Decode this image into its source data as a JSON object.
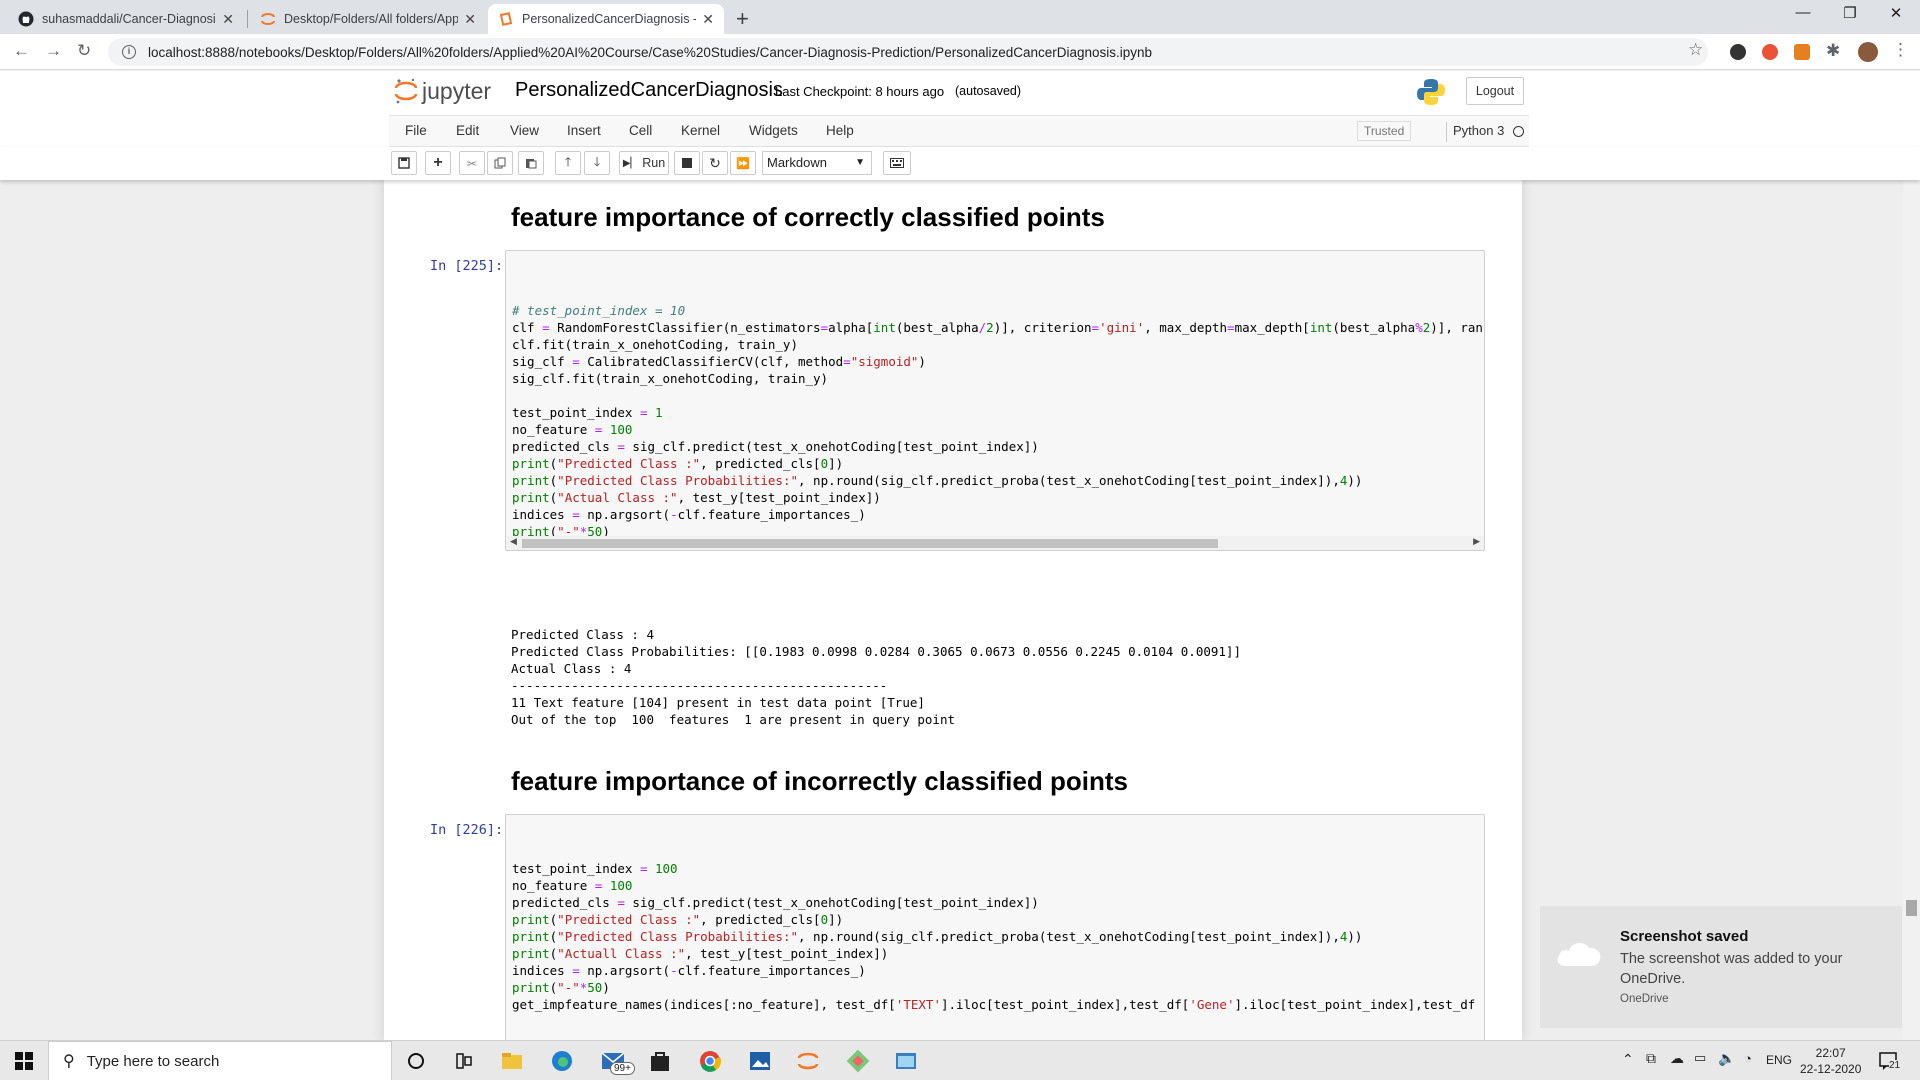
{
  "browser": {
    "tabs": [
      {
        "title": "suhasmaddali/Cancer-Diagnosis-",
        "icon": "github-icon"
      },
      {
        "title": "Desktop/Folders/All folders/Appl",
        "icon": "jupyter-icon"
      },
      {
        "title": "PersonalizedCancerDiagnosis - Ju",
        "icon": "notebook-icon"
      }
    ],
    "url": "localhost:8888/notebooks/Desktop/Folders/All%20folders/Applied%20AI%20Course/Case%20Studies/Cancer-Diagnosis-Prediction/PersonalizedCancerDiagnosis.ipynb"
  },
  "jupyter": {
    "logo_text": "jupyter",
    "notebook_name": "PersonalizedCancerDiagnosis",
    "checkpoint": "Last Checkpoint: 8 hours ago",
    "autosave": "(autosaved)",
    "logout": "Logout",
    "menu": [
      "File",
      "Edit",
      "View",
      "Insert",
      "Cell",
      "Kernel",
      "Widgets",
      "Help"
    ],
    "trusted": "Trusted",
    "kernel": "Python 3",
    "toolbar": {
      "run": "Run",
      "cell_type": "Markdown"
    }
  },
  "cells": {
    "heading1": "feature importance of correctly classified points",
    "prompt1": "In [225]:",
    "output1": [
      "Predicted Class : 4",
      "Predicted Class Probabilities: [[0.1983 0.0998 0.0284 0.3065 0.0673 0.0556 0.2245 0.0104 0.0091]]",
      "Actual Class : 4",
      "--------------------------------------------------",
      "11 Text feature [104] present in test data point [True]",
      "Out of the top  100  features  1 are present in query point"
    ],
    "heading2": "feature importance of incorrectly classified points",
    "prompt2": "In [226]:"
  },
  "toast": {
    "title": "Screenshot saved",
    "body": "The screenshot was added to your OneDrive.",
    "source": "OneDrive"
  },
  "taskbar": {
    "search_placeholder": "Type here to search",
    "badge": "99+",
    "lang": "ENG",
    "time": "22:07",
    "date": "22-12-2020",
    "notification_count": "21"
  }
}
